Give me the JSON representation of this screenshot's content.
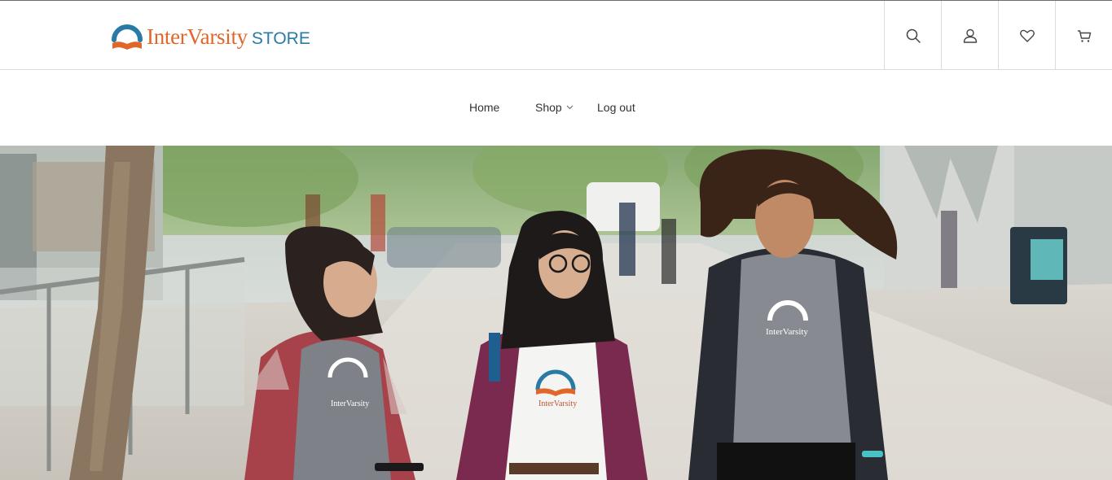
{
  "brand": {
    "name": "InterVarsity",
    "store_label": "STORE",
    "colors": {
      "orange": "#e1662a",
      "blue": "#2a7aa6"
    }
  },
  "header_icons": [
    "search-icon",
    "account-icon",
    "heart-icon",
    "cart-icon"
  ],
  "nav": {
    "items": [
      {
        "label": "Home"
      },
      {
        "label": "Shop",
        "has_dropdown": true
      },
      {
        "label": "Log out"
      }
    ]
  },
  "hero": {
    "shirt_logo_text": "InterVarsity"
  }
}
